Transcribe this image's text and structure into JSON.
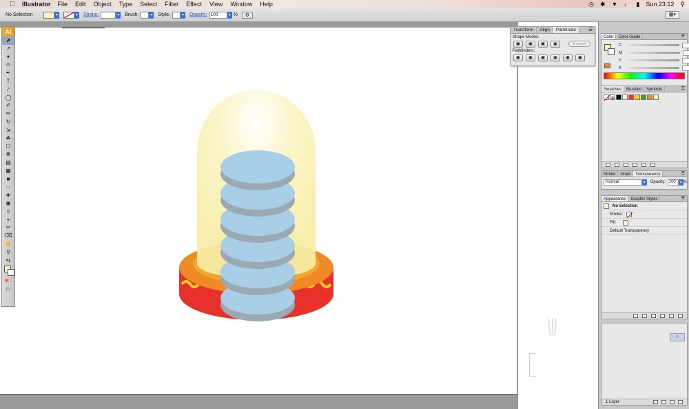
{
  "menubar": {
    "app_name": "Illustrator",
    "menus": [
      "File",
      "Edit",
      "Object",
      "Type",
      "Select",
      "Filter",
      "Effect",
      "View",
      "Window",
      "Help"
    ],
    "clock": "Sun 23:12"
  },
  "controlbar": {
    "selection": "No Selection",
    "stroke_label": "Stroke:",
    "brush_label": "Brush:",
    "style_label": "Style:",
    "opacity_label": "Opacity:",
    "opacity_value": "100",
    "opacity_unit": "%"
  },
  "toolbox": {
    "logo": "Ai",
    "tools": [
      "selection-tool",
      "direct-selection-tool",
      "magic-wand-tool",
      "lasso-tool",
      "pen-tool",
      "type-tool",
      "line-tool",
      "rectangle-tool",
      "paintbrush-tool",
      "pencil-tool",
      "rotate-tool",
      "scale-tool",
      "warp-tool",
      "free-transform-tool",
      "symbol-sprayer-tool",
      "column-graph-tool",
      "mesh-tool",
      "gradient-tool",
      "eyedropper-tool",
      "blend-tool",
      "live-paint-tool",
      "live-paint-selection-tool",
      "crop-area-tool",
      "slice-tool",
      "eraser-tool",
      "scissors-tool",
      "hand-tool",
      "zoom-tool"
    ]
  },
  "pathfinder_panel": {
    "tabs": [
      "Transform",
      "Align",
      "Pathfinder"
    ],
    "shape_modes_label": "Shape Modes:",
    "expand_label": "Expand",
    "pathfinders_label": "Pathfinders:"
  },
  "color_panel": {
    "tabs": [
      "Color",
      "Color Guide"
    ],
    "channels": [
      {
        "label": "C",
        "unit": "%"
      },
      {
        "label": "M",
        "unit": "%"
      },
      {
        "label": "Y",
        "unit": "%"
      },
      {
        "label": "K",
        "unit": "%"
      }
    ]
  },
  "swatches_panel": {
    "tabs": [
      "Swatches",
      "Brushes",
      "Symbols"
    ],
    "swatches": [
      "#000000",
      "#ffffff",
      "#e8352a",
      "#f5d220",
      "#3d9e3d",
      "#f08a24",
      "#f4f1c8"
    ]
  },
  "stroke_panel": {
    "tabs": [
      "Stroke",
      "Gradi",
      "Transparency"
    ],
    "blend_mode": "Normal",
    "opacity_label": "Opacity:",
    "opacity_value": "100",
    "opacity_unit": "%"
  },
  "appearance_panel": {
    "tabs": [
      "Appearance",
      "Graphic Styles"
    ],
    "heading": "No Selection",
    "stroke_label": "Stroke:",
    "fill_label": "Fill:",
    "transparency_label": "Default Transparency"
  },
  "layers_panel": {
    "count_label": "1 Layer"
  },
  "colors": {
    "jar": "#fbf4c4",
    "disc": "#a8cfe6",
    "disc_shadow": "#9aa9b3",
    "base_top": "#f08a24",
    "base_ring": "#f5a532",
    "base_side": "#e8312b",
    "wave": "#f7d51c"
  }
}
